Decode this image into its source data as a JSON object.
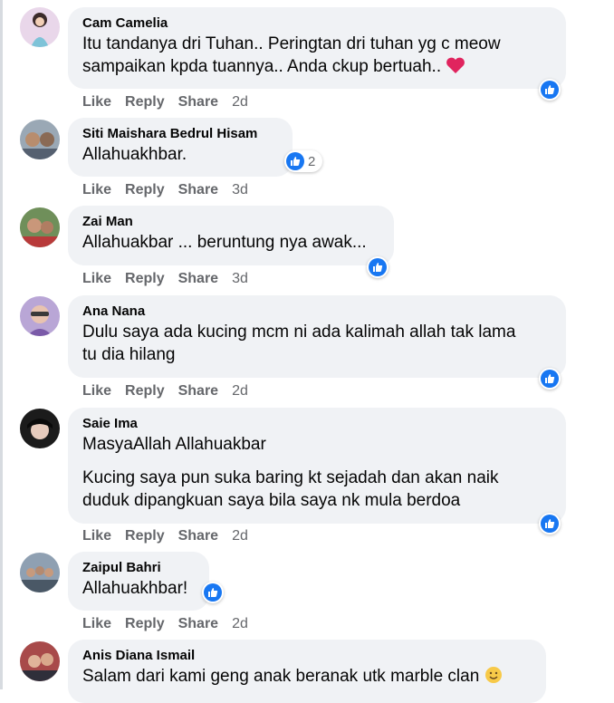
{
  "accent_color": "#1877f2",
  "comments": [
    {
      "author": "Cam Camelia",
      "text": "Itu tandanya dri Tuhan.. Peringtan dri tuhan yg c meow\nsampaikan kpda tuannya.. Anda ckup bertuah.. ",
      "emoji": "heart-icon",
      "actions": {
        "like": "Like",
        "reply": "Reply",
        "share": "Share",
        "time": "2d"
      },
      "reaction": {
        "icon": "like-icon",
        "count": ""
      }
    },
    {
      "author": "Siti Maishara Bedrul Hisam",
      "text": "Allahuakhbar.",
      "actions": {
        "like": "Like",
        "reply": "Reply",
        "share": "Share",
        "time": "3d"
      },
      "reaction": {
        "icon": "like-icon",
        "count": "2"
      }
    },
    {
      "author": "Zai Man",
      "text": "Allahuakbar ... beruntung nya awak...",
      "actions": {
        "like": "Like",
        "reply": "Reply",
        "share": "Share",
        "time": "3d"
      },
      "reaction": {
        "icon": "like-icon",
        "count": ""
      }
    },
    {
      "author": "Ana Nana",
      "text": "Dulu saya ada kucing mcm ni ada kalimah allah tak lama\ntu dia hilang",
      "actions": {
        "like": "Like",
        "reply": "Reply",
        "share": "Share",
        "time": "2d"
      },
      "reaction": {
        "icon": "like-icon",
        "count": ""
      }
    },
    {
      "author": "Saie Ima",
      "text": "MasyaAllah Allahuakbar",
      "text2": "Kucing saya pun suka baring kt sejadah dan akan naik\nduduk dipangkuan saya bila saya nk mula berdoa",
      "actions": {
        "like": "Like",
        "reply": "Reply",
        "share": "Share",
        "time": "2d"
      },
      "reaction": {
        "icon": "like-icon",
        "count": ""
      }
    },
    {
      "author": "Zaipul Bahri",
      "text": "Allahuakhbar!",
      "actions": {
        "like": "Like",
        "reply": "Reply",
        "share": "Share",
        "time": "2d"
      },
      "reaction": {
        "icon": "like-icon",
        "count": ""
      }
    },
    {
      "author": "Anis Diana Ismail",
      "text": "Salam dari kami geng anak beranak utk marble clan ",
      "emoji": "smiling-face-icon"
    }
  ]
}
